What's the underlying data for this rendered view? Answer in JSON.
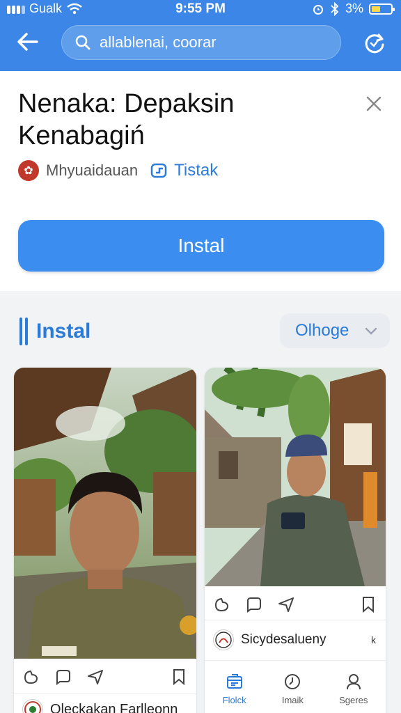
{
  "status": {
    "carrier": "Gualk",
    "time": "9:55 PM",
    "battery": "3%"
  },
  "search": {
    "query": "allablenai, coorar"
  },
  "app": {
    "title": "Nenaka: Depaksin Kenabagiń",
    "developer": "Mhyuaidauan",
    "tag": "Tistak",
    "install_label": "Instal"
  },
  "section": {
    "title": "Instal",
    "sort_label": "Olhoge"
  },
  "cards": {
    "right": {
      "author": "Sicydesalueny",
      "author_suffix": "k",
      "nav": [
        {
          "label": "Flolck",
          "icon": "store-icon"
        },
        {
          "label": "Imaik",
          "icon": "clock-icon"
        },
        {
          "label": "Sgeres",
          "icon": "person-icon"
        }
      ]
    },
    "left": {
      "author": "Oleckakan Farlleonn"
    }
  },
  "colors": {
    "header_blue": "#3b86e6",
    "accent_blue": "#2a7ad8",
    "button_blue": "#3b8df0"
  }
}
